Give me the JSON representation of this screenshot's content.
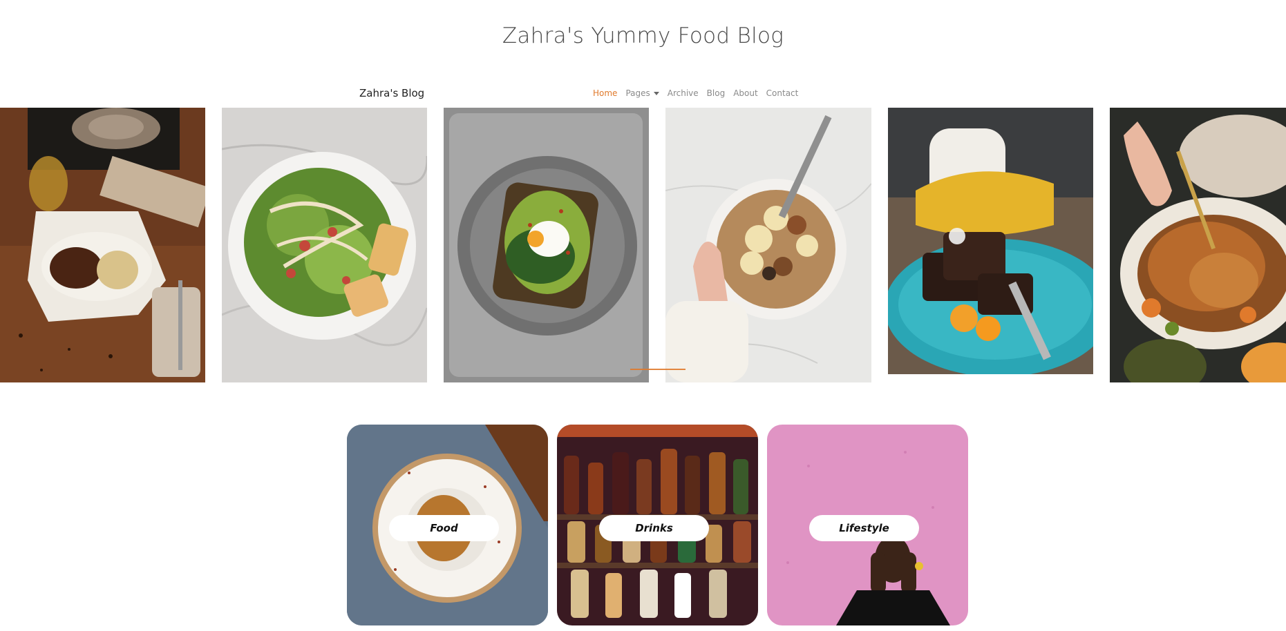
{
  "header": {
    "site_title": "Zahra's Yummy Food Blog",
    "brand": "Zahra's Blog"
  },
  "nav": {
    "items": [
      {
        "label": "Home",
        "active": true
      },
      {
        "label": "Pages",
        "dropdown": true
      },
      {
        "label": "Archive"
      },
      {
        "label": "Blog"
      },
      {
        "label": "About"
      },
      {
        "label": "Contact"
      }
    ],
    "accent_color": "#e07a2c"
  },
  "carousel": {
    "slides": [
      {
        "alt": "steak dinner on wooden table"
      },
      {
        "alt": "caesar salad on marble"
      },
      {
        "alt": "avocado toast with poached egg"
      },
      {
        "alt": "granola bowl with banana"
      },
      {
        "alt": "brownies on teal plate"
      },
      {
        "alt": "roast chicken dinner"
      }
    ]
  },
  "categories": [
    {
      "label": "Food"
    },
    {
      "label": "Drinks"
    },
    {
      "label": "Lifestyle"
    }
  ]
}
